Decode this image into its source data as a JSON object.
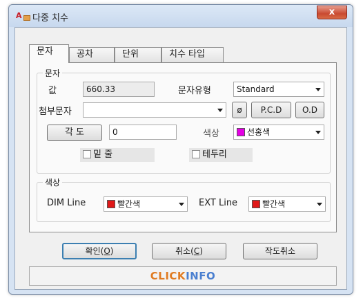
{
  "window": {
    "title": "다중 치수",
    "app_icon": "A",
    "close_label": "x"
  },
  "tabs": [
    {
      "label": "문자",
      "active": true
    },
    {
      "label": "공차"
    },
    {
      "label": "단위"
    },
    {
      "label": "치수 타입"
    }
  ],
  "text_group": {
    "label": "문자",
    "value_label": "값",
    "value": "660.33",
    "text_type_label": "문자유형",
    "text_type_value": "Standard",
    "attach_label": "첨부문자",
    "attach_value": "",
    "phi_label": "ø",
    "pcd_label": "P.C.D",
    "od_label": "O.D",
    "angle_label": "각 도",
    "angle_value": "0",
    "color_label": "색상",
    "color_value": "선홍색",
    "color_hex": "#e400e4",
    "underline_label": "밑 줄",
    "border_label": "테두리"
  },
  "color_group": {
    "label": "색상",
    "dim_line_label": "DIM Line",
    "dim_line_value": "빨간색",
    "dim_line_hex": "#e01818",
    "ext_line_label": "EXT Line",
    "ext_line_value": "빨간색",
    "ext_line_hex": "#e01818"
  },
  "buttons": {
    "ok_text": "확인(",
    "ok_key": "O",
    "cancel_text": "취소(",
    "cancel_key": "C",
    "cancel_draw": "작도취소"
  },
  "logo": {
    "part1": "CLICK",
    "part2": "INFO"
  }
}
